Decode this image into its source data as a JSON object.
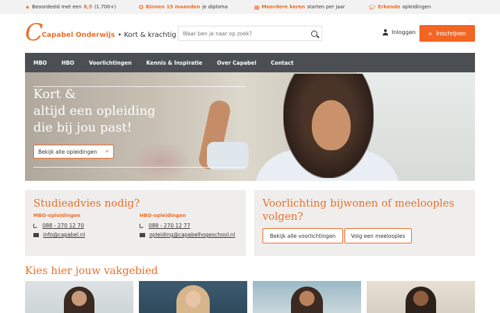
{
  "topbar": {
    "rating": {
      "prefix": "Beoordeeld met een",
      "score": "8,5",
      "count": "(1.700+)",
      "icon": "star-icon"
    },
    "diploma": {
      "highlight": "Binnen 15 maanden",
      "rest": "je diploma",
      "icon": "award-icon"
    },
    "start": {
      "highlight": "Meerdere keren",
      "rest": "starten per jaar",
      "icon": "calendar-icon"
    },
    "erkend": {
      "highlight": "Erkende",
      "rest": "opleidingen",
      "icon": "graduation-cap-icon"
    }
  },
  "header": {
    "logo_letter": "C",
    "brand": "Capabel Onderwijs",
    "tagline": "• Kort & krachtig",
    "search_placeholder": "Waar ben je naar op zoek?",
    "login": "Inloggen",
    "signup": "Inschrijven"
  },
  "nav": [
    "MBO",
    "HBO",
    "Voorlichtingen",
    "Kennis & Inspiratie",
    "Over Capabel",
    "Contact"
  ],
  "hero": {
    "headline_1": "Kort &",
    "headline_2": "altijd een opleiding",
    "headline_3": "die bij jou past!",
    "cta": "Bekijk alle opleidingen"
  },
  "studieadvies": {
    "title": "Studieadvies nodig?",
    "mbo": {
      "head": "MBO-opleidingen",
      "phone": "088 - 270 12 70",
      "email": "info@capabel.nl"
    },
    "hbo": {
      "head": "HBO-opleidingen",
      "phone": "088 - 270 12 77",
      "email": "opleiding@capabelhogeschool.nl"
    }
  },
  "voorlichting": {
    "title_1": "Voorlichting bijwonen of meelooples",
    "title_2": "volgen?",
    "btn_all": "Bekijk alle voorlichtingen",
    "btn_meeloop": "Volg een meelooples"
  },
  "vakgebied": {
    "title": "Kies hier jouw vakgebied"
  },
  "colors": {
    "accent": "#f26522",
    "nav_bg": "#4b4f54",
    "card_bg": "#f0eeed"
  }
}
